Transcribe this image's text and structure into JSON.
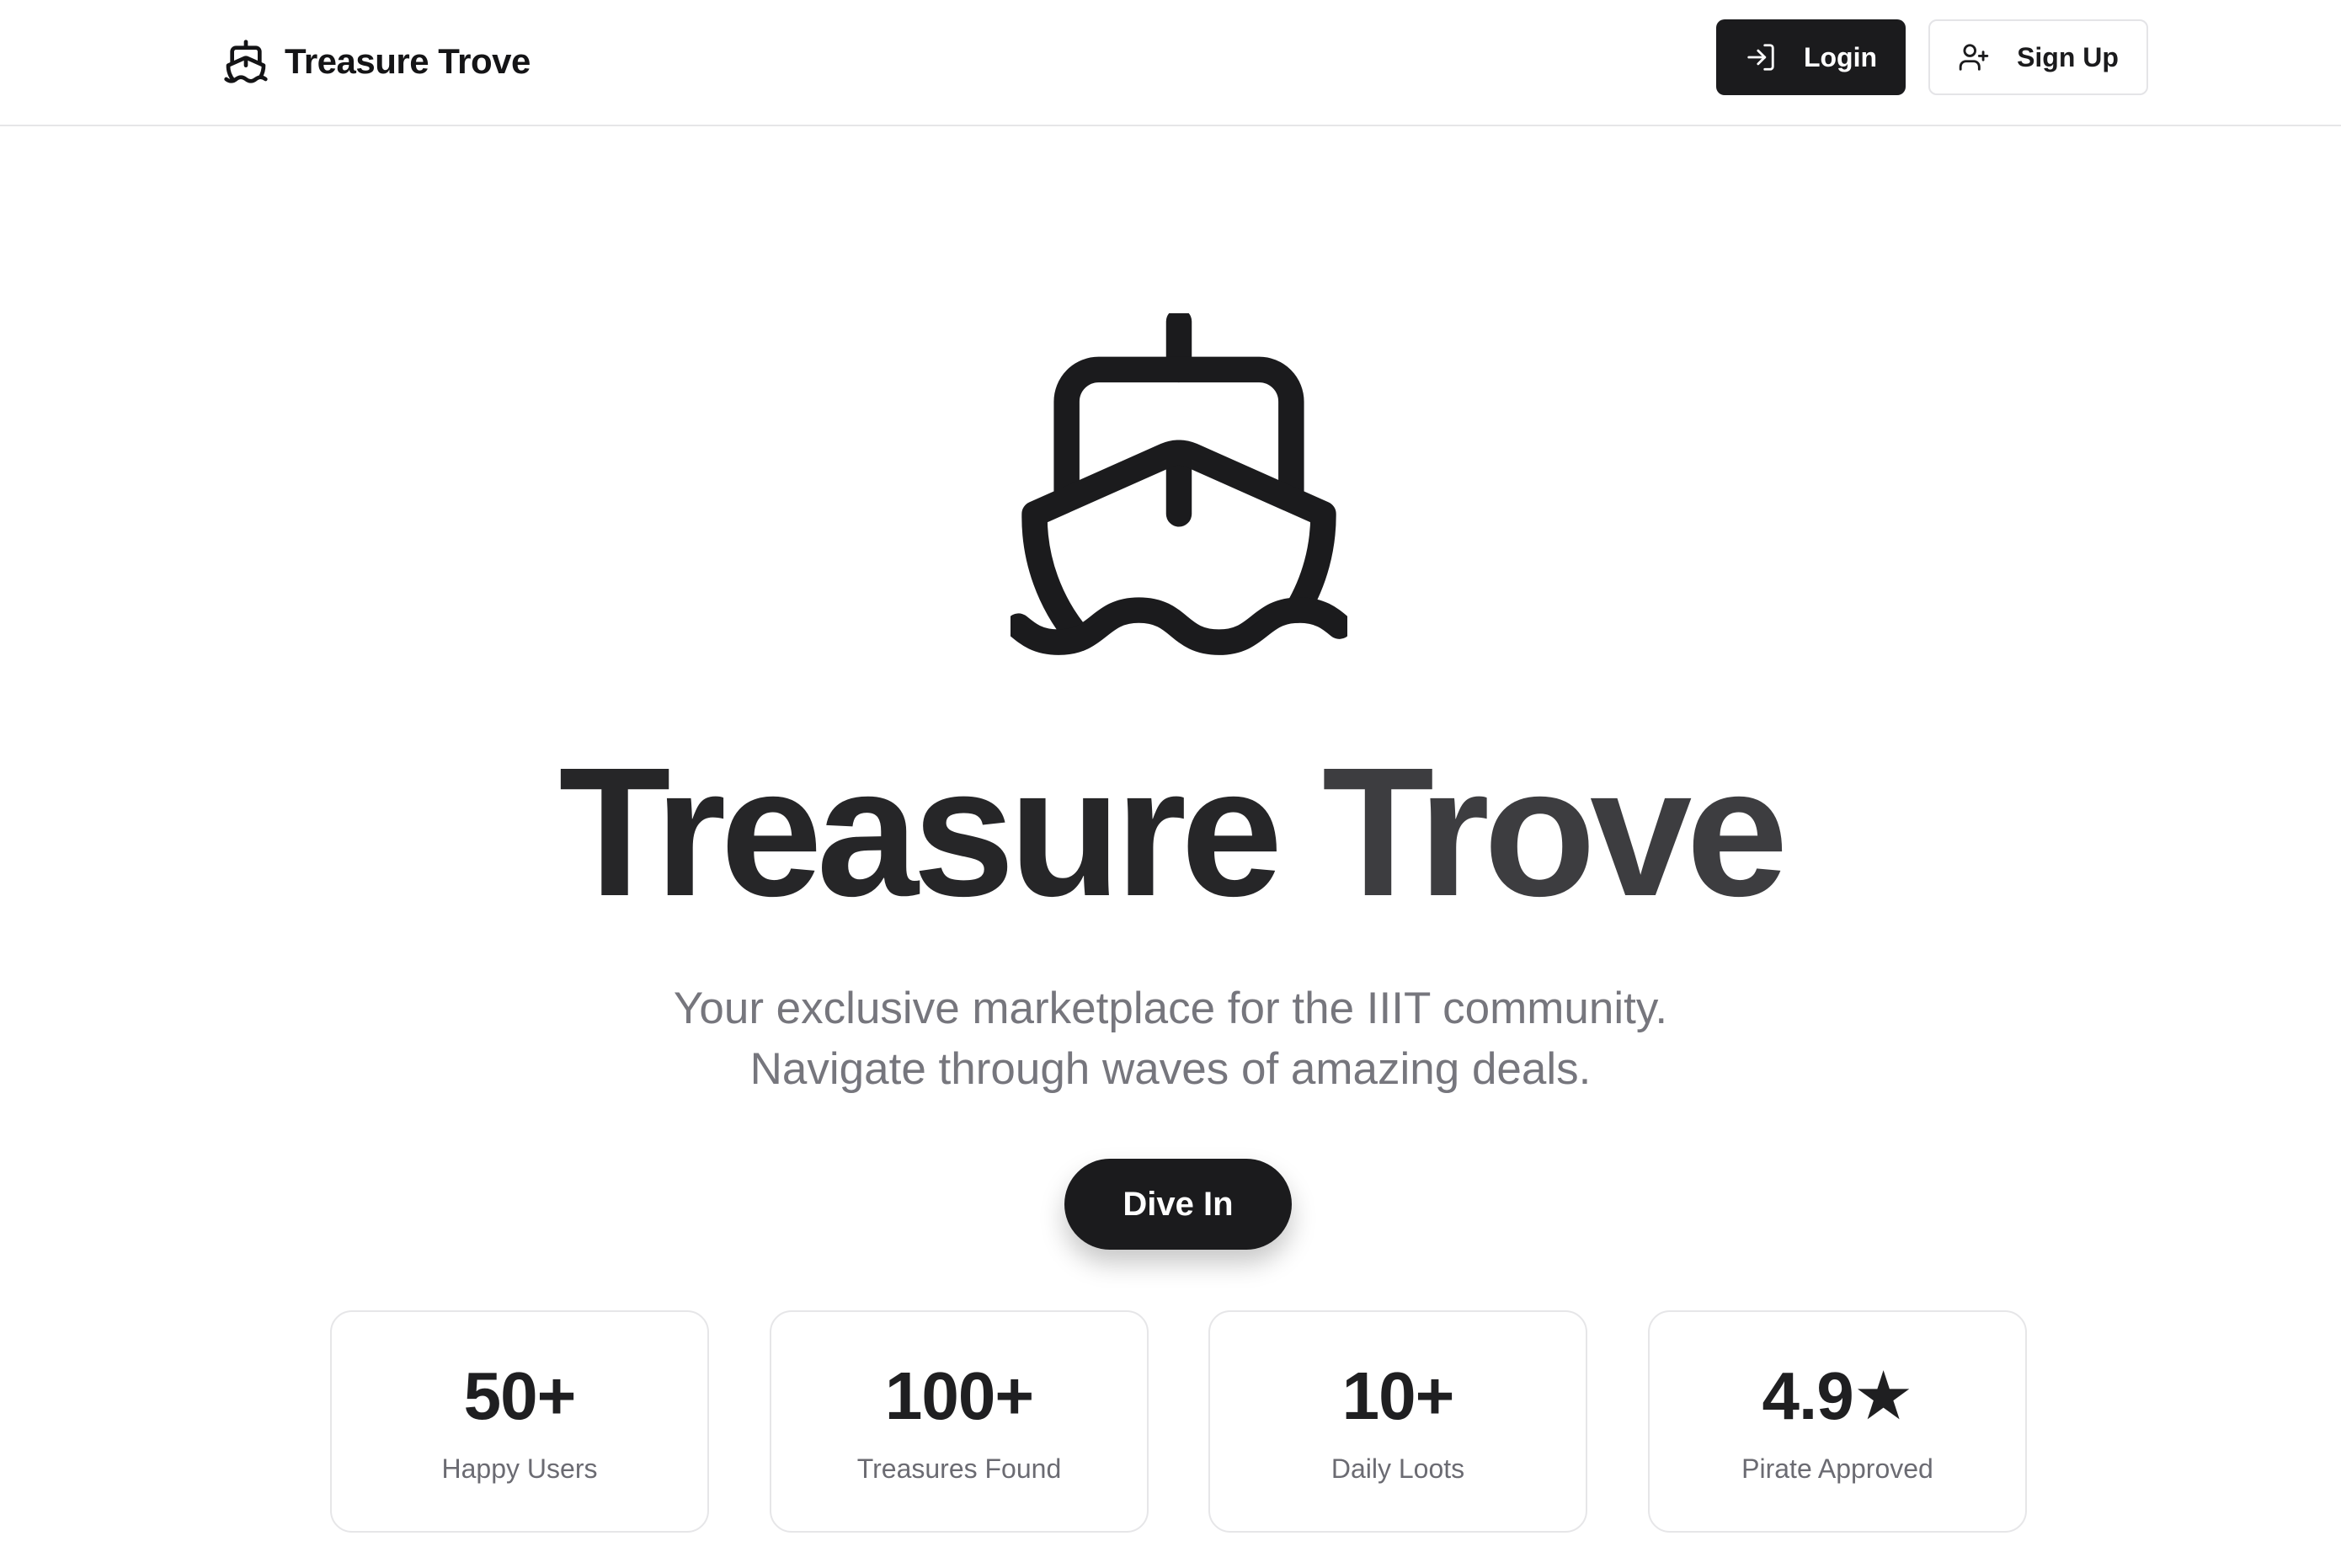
{
  "header": {
    "brand_icon": "ship-icon",
    "brand_title": "Treasure Trove",
    "login_label": "Login",
    "login_icon": "log-in-icon",
    "signup_label": "Sign Up",
    "signup_icon": "user-plus-icon"
  },
  "hero": {
    "icon": "ship-icon",
    "title_word_1": "Treasure",
    "title_word_2": "Trove",
    "subtitle_line_1": "Your exclusive marketplace for the IIIT community.",
    "subtitle_line_2": "Navigate through waves of amazing deals.",
    "cta_label": "Dive In"
  },
  "stats": [
    {
      "value": "50+",
      "label": "Happy Users"
    },
    {
      "value": "100+",
      "label": "Treasures Found"
    },
    {
      "value": "10+",
      "label": "Daily Loots"
    },
    {
      "value": "4.9★",
      "label": "Pirate Approved"
    }
  ],
  "colors": {
    "primary": "#1b1b1d",
    "background": "#ffffff",
    "muted_text": "#76767d",
    "border": "#e6e6e8"
  }
}
